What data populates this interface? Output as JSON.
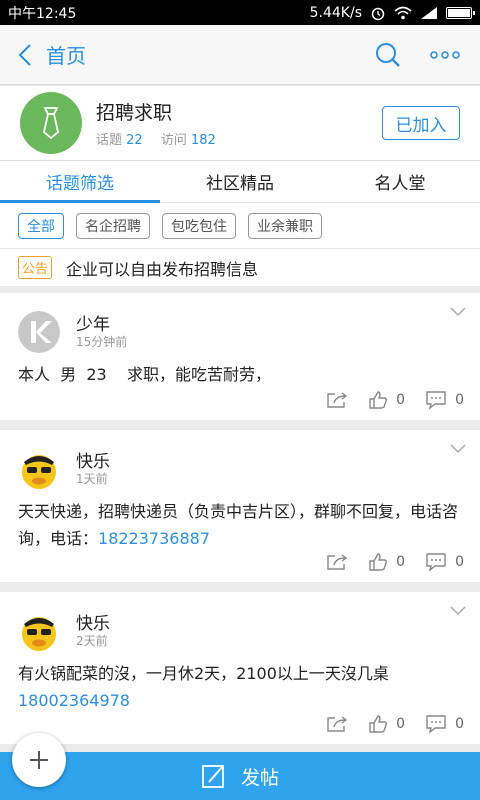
{
  "status_bar": {
    "time": "中午12:45",
    "speed": "5.44K/s"
  },
  "nav": {
    "back_label": "首页"
  },
  "group": {
    "name": "招聘求职",
    "topics_label": "话题",
    "topics_count": "22",
    "visits_label": "访问",
    "visits_count": "182",
    "join_label": "已加入"
  },
  "tabs": [
    {
      "label": "话题筛选"
    },
    {
      "label": "社区精品"
    },
    {
      "label": "名人堂"
    }
  ],
  "filters": [
    {
      "label": "全部"
    },
    {
      "label": "名企招聘"
    },
    {
      "label": "包吃包住"
    },
    {
      "label": "业余兼职"
    }
  ],
  "notice": {
    "tag": "公告",
    "text": "企业可以自由发布招聘信息"
  },
  "posts": [
    {
      "author": "少年",
      "time": "15分钟前",
      "text": "本人  男  23    求职，能吃苦耐劳，",
      "phone": "",
      "likes": "0",
      "comments": "0"
    },
    {
      "author": "快乐",
      "time": "1天前",
      "text": "天天快递，招聘快递员（负责中吉片区），群聊不回复，电话咨询，电话：",
      "phone": "18223736887",
      "likes": "0",
      "comments": "0"
    },
    {
      "author": "快乐",
      "time": "2天前",
      "text": "有火锅配菜的沒，一月休2天，2100以上一天沒几桌",
      "phone": "18002364978",
      "likes": "0",
      "comments": "0"
    }
  ],
  "bottom_bar": {
    "post_label": "发帖"
  },
  "colors": {
    "accent": "#2b8fe0",
    "bar": "#2fa3ee",
    "group_avatar": "#6ab85b",
    "notice": "#f0a020"
  }
}
